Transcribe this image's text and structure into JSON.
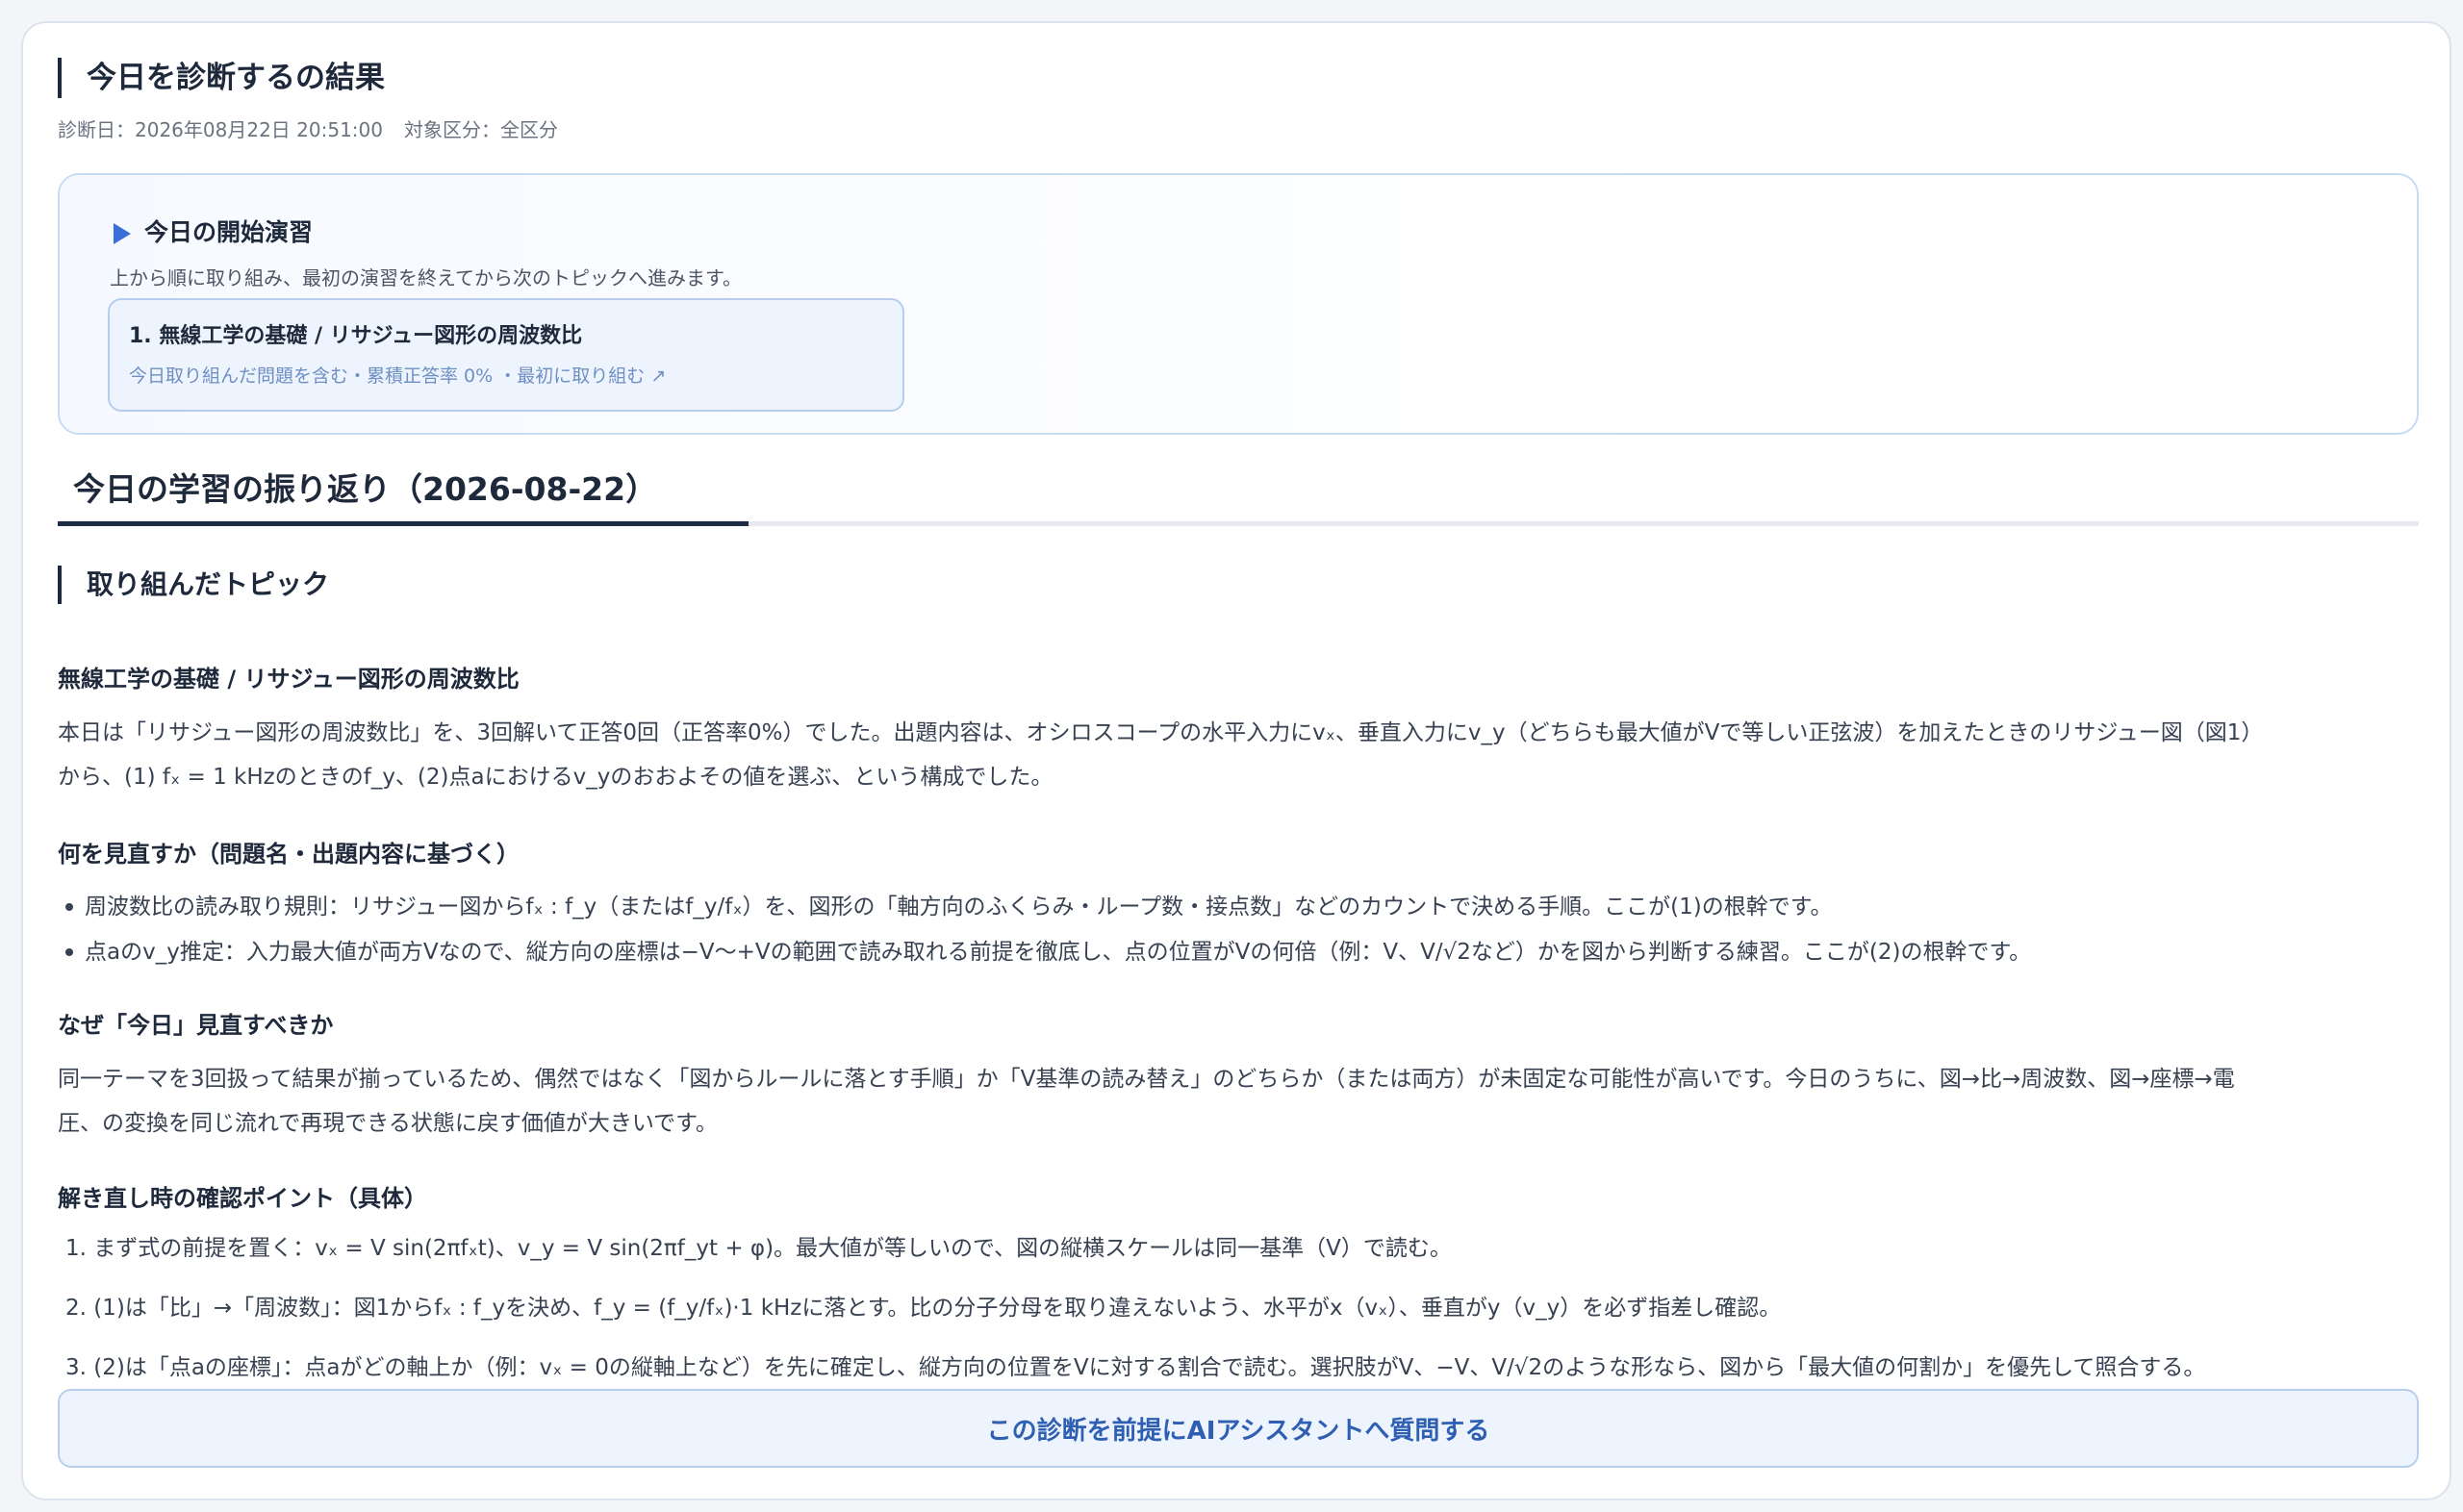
{
  "header": {
    "title": "今日を診断するの結果",
    "diagnosis_date": "診断日：2026年08月22日 20:51:00",
    "target": "対象区分：全区分"
  },
  "start_exercise": {
    "title": "今日の開始演習",
    "description": "上から順に取り組み、最初の演習を終えてから次のトピックへ進みます。",
    "topic": {
      "title": "1. 無線工学の基礎 / リサジュー図形の周波数比",
      "meta": "今日取り組んだ問題を含む・累積正答率 0% ・最初に取り組む ↗"
    }
  },
  "review": {
    "title": "今日の学習の振り返り（2026-08-22）",
    "topics_heading": "取り組んだトピック",
    "topic_name": "無線工学の基礎 / リサジュー図形の周波数比",
    "summary_line1": "本日は「リサジュー図形の周波数比」を、3回解いて正答0回（正答率0%）でした。出題内容は、オシロスコープの水平入力にvₓ、垂直入力にv_y（どちらも最大値がVで等しい正弦波）を加えたときのリサジュー図（図1）",
    "summary_line2": "から、(1) fₓ = 1 kHzのときのf_y、(2)点aにおけるv_yのおおよその値を選ぶ、という構成でした。",
    "what_heading": "何を見直すか（問題名・出題内容に基づく）",
    "what_items": [
      "周波数比の読み取り規則：リサジュー図からfₓ : f_y（またはf_y/fₓ）を、図形の「軸方向のふくらみ・ループ数・接点数」などのカウントで決める手順。ここが(1)の根幹です。",
      "点aのv_y推定：入力最大値が両方Vなので、縦方向の座標は−V〜+Vの範囲で読み取れる前提を徹底し、点の位置がVの何倍（例：V、V/√2など）かを図から判断する練習。ここが(2)の根幹です。"
    ],
    "why_heading": "なぜ「今日」見直すべきか",
    "why_line1": "同一テーマを3回扱って結果が揃っているため、偶然ではなく「図からルールに落とす手順」か「V基準の読み替え」のどちらか（または両方）が未固定な可能性が高いです。今日のうちに、図→比→周波数、図→座標→電",
    "why_line2": "圧、の変換を同じ流れで再現できる状態に戻す価値が大きいです。",
    "check_heading": "解き直し時の確認ポイント（具体）",
    "check_items": [
      "1. まず式の前提を置く：vₓ = V sin(2πfₓt)、v_y = V sin(2πf_yt + φ)。最大値が等しいので、図の縦横スケールは同一基準（V）で読む。",
      "2. (1)は「比」→「周波数」：図1からfₓ : f_yを決め、f_y = (f_y/fₓ)·1 kHzに落とす。比の分子分母を取り違えないよう、水平がx（vₓ）、垂直がy（v_y）を必ず指差し確認。",
      "3. (2)は「点aの座標」：点aがどの軸上か（例：vₓ = 0の縦軸上など）を先に確定し、縦方向の位置をVに対する割合で読む。選択肢がV、−V、V/√2のような形なら、図から「最大値の何割か」を優先して照合する。"
    ]
  },
  "ask_button": "この診断を前提にAIアシスタントへ質問する"
}
